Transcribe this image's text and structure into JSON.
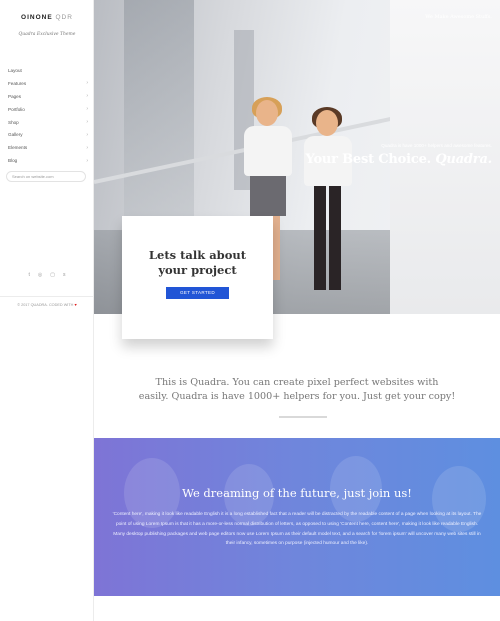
{
  "sidebar": {
    "logo_bold": "OINONE",
    "logo_light": "QDR",
    "tagline": "Quadra Exclusive Theme",
    "menu": [
      {
        "label": "Layout",
        "chevron": ""
      },
      {
        "label": "Features",
        "chevron": "›"
      },
      {
        "label": "Pages",
        "chevron": "›"
      },
      {
        "label": "Portfolio",
        "chevron": "›"
      },
      {
        "label": "Shop",
        "chevron": "›"
      },
      {
        "label": "Gallery",
        "chevron": "›"
      },
      {
        "label": "Elements",
        "chevron": "›"
      },
      {
        "label": "Blog",
        "chevron": "›"
      }
    ],
    "search_placeholder": "Search on website.com",
    "socials": [
      {
        "icon": "twitter-icon",
        "glyph": "t"
      },
      {
        "icon": "pinterest-icon",
        "glyph": "◎"
      },
      {
        "icon": "instagram-icon",
        "glyph": "▢"
      },
      {
        "icon": "skype-icon",
        "glyph": "s"
      }
    ],
    "copyright": "© 2017 QUADRA. CODED WITH",
    "heart": "♥"
  },
  "hero": {
    "top_text": "We Make Awesome Stuffs.",
    "small_text": "Quadra is have 1000+ helpers and awesome features.",
    "title_main": "Your Best Choice.",
    "title_italic": "Quadra."
  },
  "cta": {
    "title_line1": "Lets talk about",
    "title_line2": "your project",
    "button": "GET STARTED"
  },
  "intro": {
    "line1": "This is Quadra. You can create pixel perfect websites with",
    "line2": "easily. Quadra is have 1000+ helpers for you. Just get your copy!"
  },
  "banner": {
    "title": "We dreaming of the future, just join us!",
    "text": "'Content here', making it look like readable English it is a long established fact that a reader will be distracted by the readable content of a page when looking at its layout. The point of using Lorem Ipsum is that it has a more-or-less normal distribution of letters, as opposed to using 'Content here, content here', making it look like readable English. Many desktop publishing packages and web page editors now use Lorem Ipsum as their default model text, and a search for 'lorem ipsum' will uncover many web sites still in their infancy, sometimes on purpose (injected humour and the like)."
  },
  "colors": {
    "accent": "#2155d6",
    "banner_start": "#7e74d6",
    "banner_end": "#5e8fe0"
  }
}
